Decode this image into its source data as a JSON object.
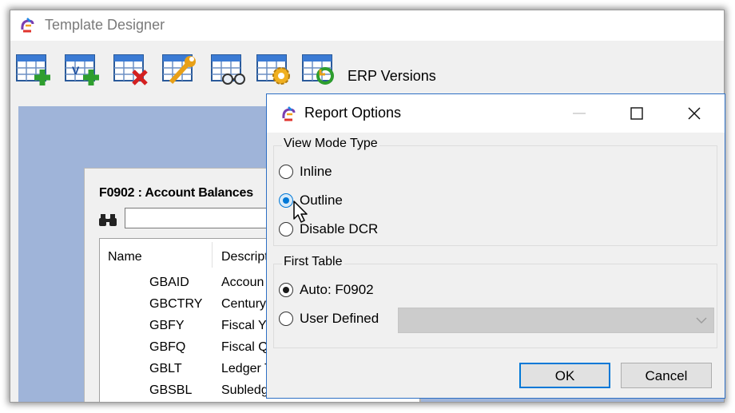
{
  "main_window": {
    "title": "Template Designer"
  },
  "toolbar": {
    "buttons": [
      {
        "name": "add-table",
        "icon": "table-plus-icon"
      },
      {
        "name": "add-version",
        "icon": "table-v-plus-icon"
      },
      {
        "name": "delete-table",
        "icon": "table-delete-icon"
      },
      {
        "name": "edit-table",
        "icon": "table-wrench-icon"
      },
      {
        "name": "view-table",
        "icon": "table-glasses-icon"
      },
      {
        "name": "settings-table",
        "icon": "table-gear-icon"
      },
      {
        "name": "refresh-table",
        "icon": "table-refresh-icon"
      }
    ],
    "erp_label": "ERP Versions"
  },
  "table_panel": {
    "title": "F0902 : Account Balances",
    "search_icon": "binoculars-icon",
    "columns": [
      "Name",
      "Descript"
    ],
    "rows": [
      {
        "name": "GBAID",
        "desc": "Accoun"
      },
      {
        "name": "GBCTRY",
        "desc": "Century"
      },
      {
        "name": "GBFY",
        "desc": "Fiscal Y"
      },
      {
        "name": "GBFQ",
        "desc": "Fiscal Q"
      },
      {
        "name": "GBLT",
        "desc": "Ledger T"
      },
      {
        "name": "GBSBL",
        "desc": "Subledg"
      }
    ]
  },
  "dialog": {
    "title": "Report Options",
    "view_mode": {
      "label": "View Mode Type",
      "options": [
        "Inline",
        "Outline",
        "Disable DCR"
      ],
      "selected": "Outline"
    },
    "first_table": {
      "label": "First Table",
      "options": [
        "Auto: F0902",
        "User Defined"
      ],
      "selected": "Auto: F0902",
      "dropdown_value": ""
    },
    "ok_label": "OK",
    "cancel_label": "Cancel"
  },
  "colors": {
    "accent": "#0078d7",
    "workspace": "#9fb4d9"
  }
}
